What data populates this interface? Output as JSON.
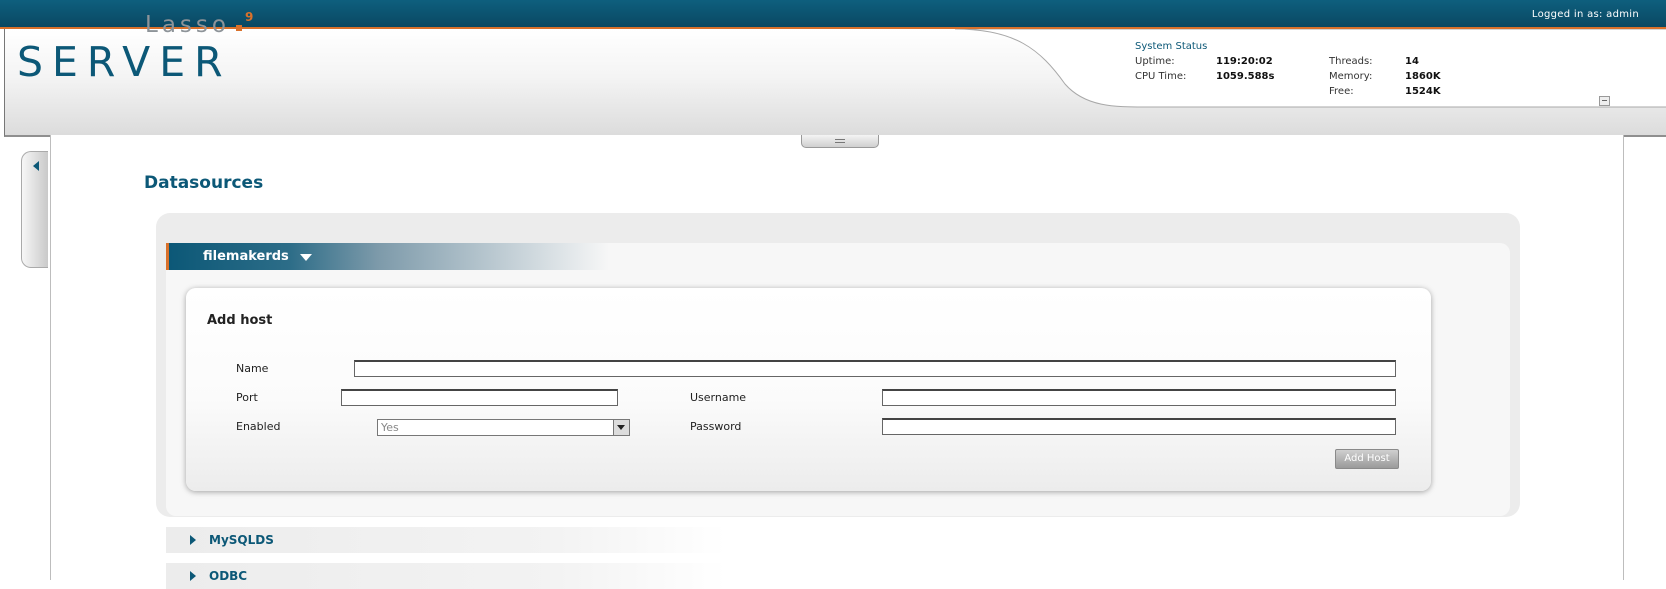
{
  "topbar": {
    "logged_in_text": "Logged in as: admin"
  },
  "logo": {
    "small_word": "Lasso",
    "superscript": "9",
    "big_word": "SERVER"
  },
  "system_status": {
    "title": "System Status",
    "uptime_label": "Uptime:",
    "uptime_value": "119:20:02",
    "cpu_label": "CPU Time:",
    "cpu_value": "1059.588s",
    "threads_label": "Threads:",
    "threads_value": "14",
    "memory_label": "Memory:",
    "memory_value": "1860K",
    "free_label": "Free:",
    "free_value": "1524K"
  },
  "page": {
    "title": "Datasources"
  },
  "datasource": {
    "name": "filemakerds",
    "add_host": {
      "title": "Add host",
      "name_label": "Name",
      "port_label": "Port",
      "enabled_label": "Enabled",
      "enabled_value": "Yes",
      "username_label": "Username",
      "password_label": "Password",
      "name_value": "",
      "port_value": "",
      "username_value": "",
      "password_value": "",
      "submit_label": "Add Host"
    }
  },
  "other_datasources": [
    {
      "name": "MySQLDS"
    },
    {
      "name": "ODBC"
    }
  ],
  "colors": {
    "brand": "#0c5877",
    "accent": "#d9712b"
  }
}
